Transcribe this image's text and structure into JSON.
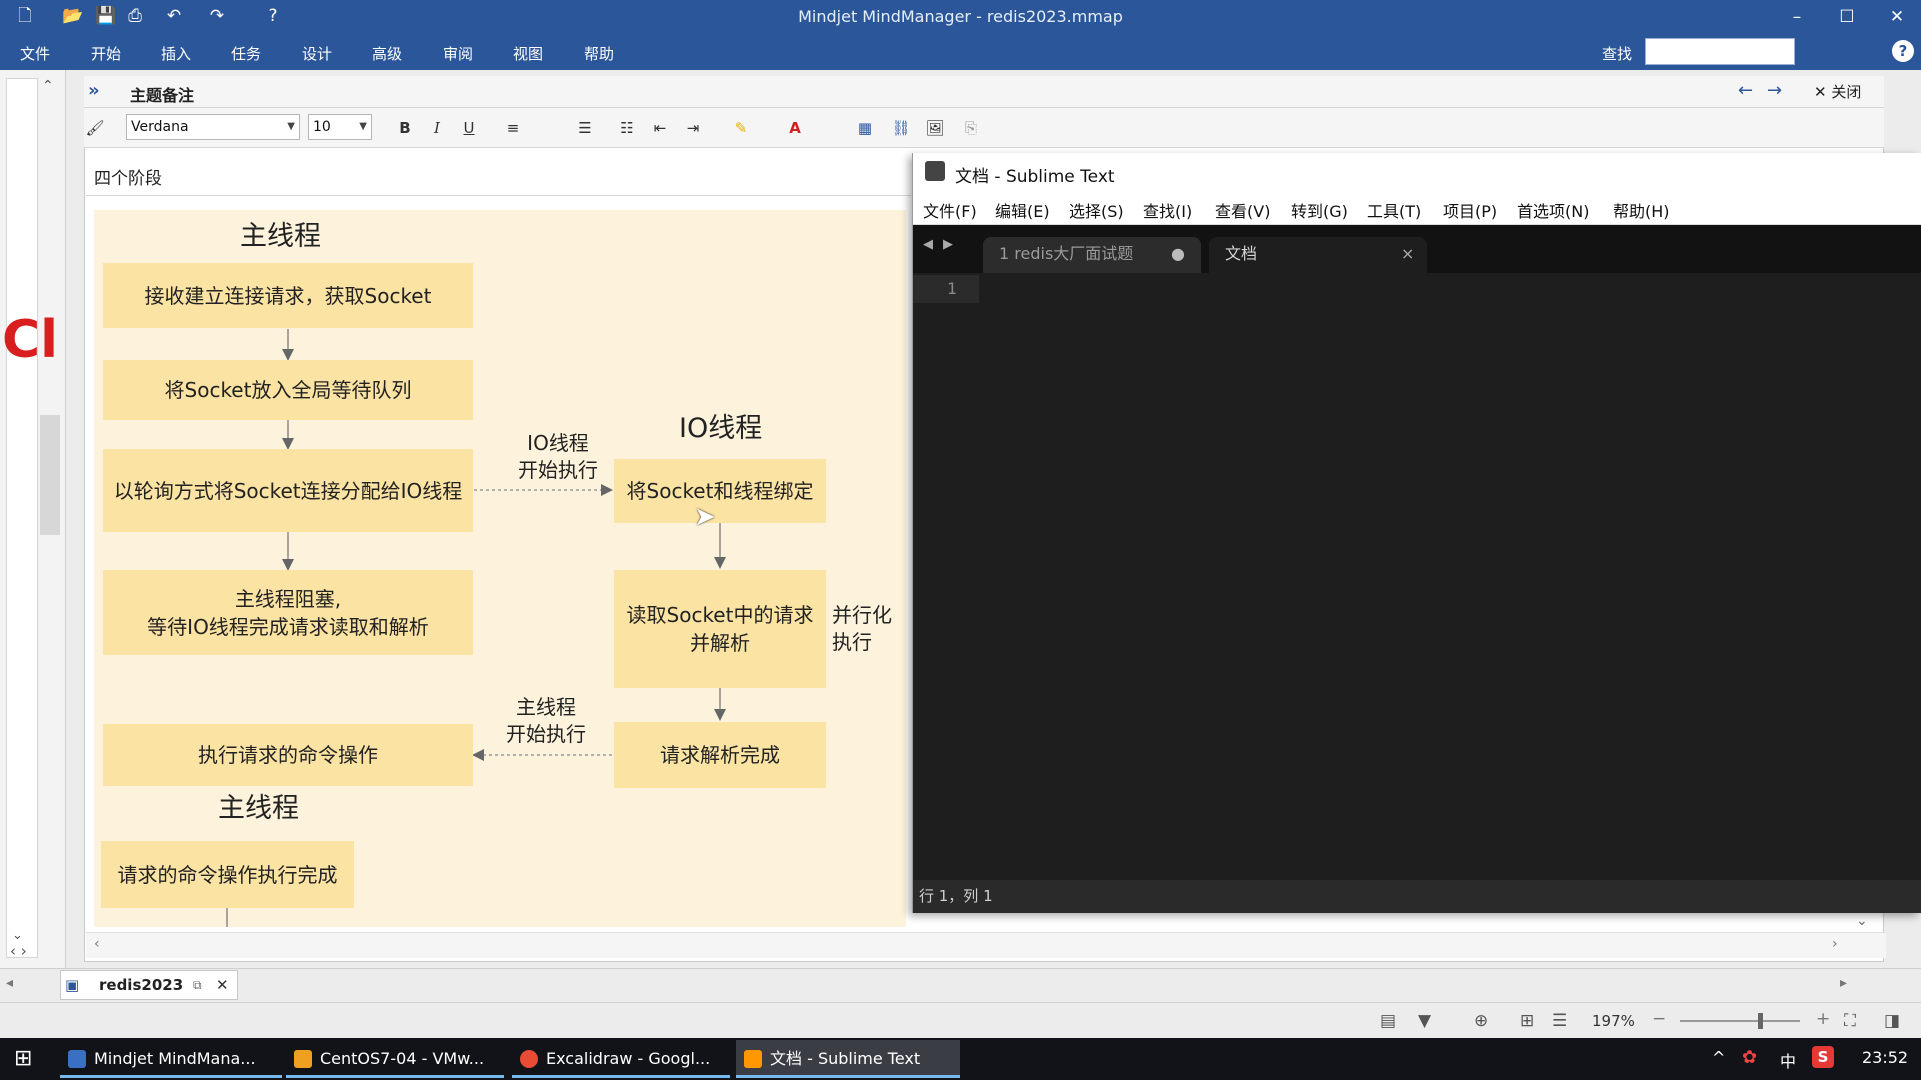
{
  "window": {
    "title": "Mindjet MindManager - redis2023.mmap"
  },
  "menu": {
    "items": [
      "文件",
      "开始",
      "插入",
      "任务",
      "设计",
      "高级",
      "审阅",
      "视图",
      "帮助"
    ],
    "search_label": "查找"
  },
  "notes_panel": {
    "title": "主题备注",
    "close_label": "关闭",
    "font": "Verdana",
    "font_size": "10",
    "note_title": "四个阶段"
  },
  "diagram": {
    "main_header_top": "主线程",
    "main_header_bottom": "主线程",
    "io_header": "IO线程",
    "boxes": {
      "accept": "接收建立连接请求，获取Socket",
      "queue": "将Socket放入全局等待队列",
      "dispatch": "以轮询方式将Socket连接分配给IO线程",
      "block_line1": "主线程阻塞,",
      "block_line2": "等待IO线程完成请求读取和解析",
      "execute": "执行请求的命令操作",
      "done": "请求的命令操作执行完成",
      "bind": "将Socket和线程绑定",
      "read_line1": "读取Socket中的请求",
      "read_line2": "并解析",
      "parsed": "请求解析完成"
    },
    "labels": {
      "io_start_line1": "IO线程",
      "io_start_line2": "开始执行",
      "parallel_line1": "并行化",
      "parallel_line2": "执行",
      "main_start_line1": "主线程",
      "main_start_line2": "开始执行"
    }
  },
  "sublime": {
    "title": "文档 - Sublime Text",
    "menu": [
      "文件(F)",
      "编辑(E)",
      "选择(S)",
      "查找(I)",
      "查看(V)",
      "转到(G)",
      "工具(T)",
      "项目(P)",
      "首选项(N)",
      "帮助(H)"
    ],
    "tabs": [
      {
        "label": "1 redis大厂面试题",
        "modified_dot": "●"
      },
      {
        "label": "文档",
        "close": "×"
      }
    ],
    "line_number": "1",
    "status": "行 1，列 1"
  },
  "document_tab": {
    "label": "redis2023"
  },
  "status_bar": {
    "zoom": "197%"
  },
  "taskbar": {
    "items": [
      {
        "label": "Mindjet MindMana...",
        "color": "#3a6fc4"
      },
      {
        "label": "CentOS7-04 - VMw...",
        "color": "#f0a020"
      },
      {
        "label": "Excalidraw - Googl...",
        "color": "#e94b35"
      },
      {
        "label": "文档 - Sublime Text",
        "color": "#ff9800"
      }
    ],
    "ime": "中",
    "clock": "23:52"
  },
  "colors": {
    "ribbon": "#2b579a",
    "diagram_bg": "#fdf3dc",
    "box": "#fbe3a3",
    "sublime_bg": "#1e1e1e"
  }
}
